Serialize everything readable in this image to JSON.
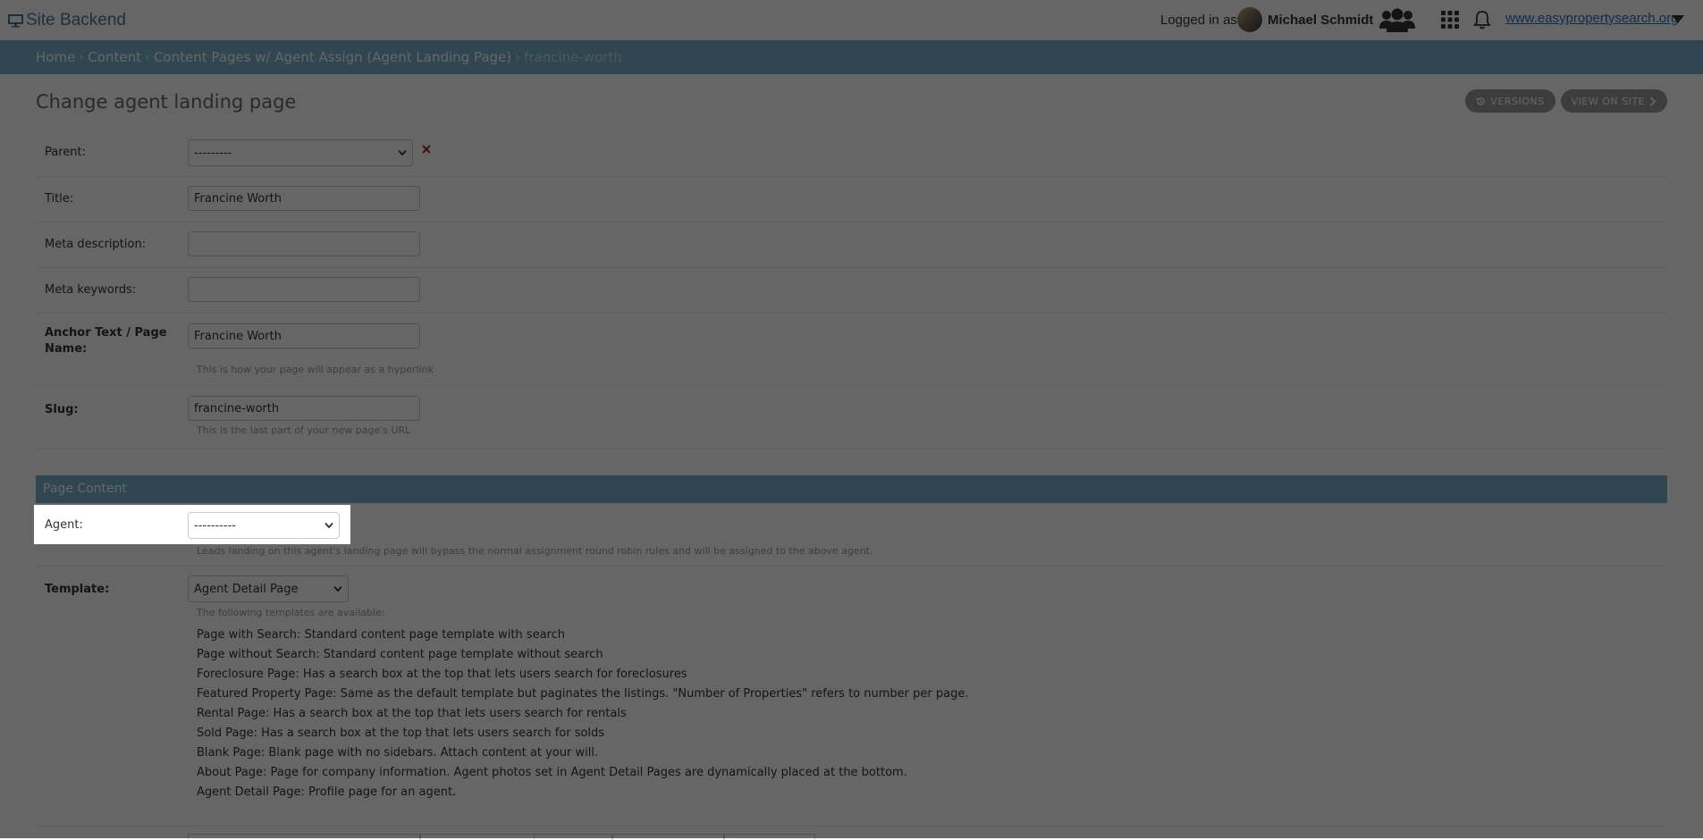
{
  "header": {
    "brand": "Site Backend",
    "logged_in_as": "Logged in as",
    "user_name": "Michael Schmidt",
    "site_link": "www.easypropertysearch.org"
  },
  "breadcrumbs": {
    "home": "Home",
    "content": "Content",
    "section": "Content Pages w/ Agent Assign (Agent Landing Page)",
    "current": "francine-worth",
    "separator": "›"
  },
  "page": {
    "title": "Change agent landing page",
    "versions_label": "VERSIONS",
    "view_on_site_label": "VIEW ON SITE"
  },
  "form": {
    "parent": {
      "label": "Parent:",
      "value": "---------"
    },
    "title": {
      "label": "Title:",
      "value": "Francine Worth"
    },
    "meta_description": {
      "label": "Meta description:",
      "value": ""
    },
    "meta_keywords": {
      "label": "Meta keywords:",
      "value": ""
    },
    "anchor_text": {
      "label": "Anchor Text / Page Name:",
      "value": "Francine Worth",
      "help": "This is how your page will appear as a hyperlink"
    },
    "slug": {
      "label": "Slug:",
      "value": "francine-worth",
      "help": "This is the last part of your new page's URL"
    }
  },
  "page_content": {
    "heading": "Page Content",
    "agent": {
      "label": "Agent:",
      "value": "----------",
      "help": "Leads landing on this agent's landing page will bypass the normal assignment round robin rules and will be assigned to the above agent."
    },
    "template": {
      "label": "Template:",
      "value": "Agent Detail Page",
      "help": "The following templates are available:",
      "descriptions": [
        "Page with Search: Standard content page template with search",
        "Page without Search: Standard content page template without search",
        "Foreclosure Page: Has a search box at the top that lets users search for foreclosures",
        "Featured Property Page: Same as the default template but paginates the listings. \"Number of Properties\" refers to number per page.",
        "Rental Page: Has a search box at the top that lets users search for rentals",
        "Sold Page: Has a search box at the top that lets users search for solds",
        "Blank Page: Blank page with no sidebars. Attach content at your will.",
        "About Page: Page for company information. Agent photos set in Agent Detail Pages are dynamically placed at the bottom.",
        "Agent Detail Page: Profile page for an agent."
      ]
    }
  },
  "icons": {
    "brand": "monitor-icon",
    "users": "users-icon",
    "apps": "apps-grid-icon",
    "notifications": "bell-icon",
    "site_menu": "caret-down-icon",
    "versions": "history-icon",
    "view_on_site": "chevron-right-icon",
    "parent_clear": "delete-x-icon"
  },
  "colors": {
    "accent": "#79aec8",
    "link": "#2a6fbe",
    "brand_text": "#447e9b",
    "tool_button": "#999999",
    "delete_icon": "#ba2121"
  }
}
